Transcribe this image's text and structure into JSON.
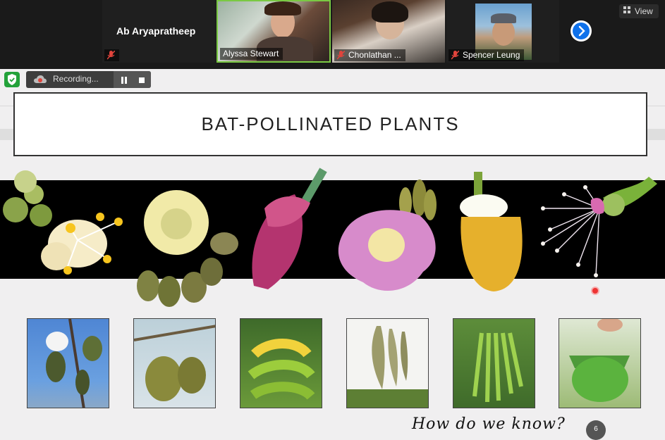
{
  "participants": [
    {
      "name": "Ab Aryapratheep",
      "muted": true
    },
    {
      "name": "Alyssa Stewart",
      "muted": false
    },
    {
      "name": "Chonlathan ...",
      "muted": true
    },
    {
      "name": "Spencer Leung",
      "muted": true
    }
  ],
  "view_button": {
    "label": "View",
    "icon": "grid-icon"
  },
  "recording": {
    "label": "Recording...",
    "pause_icon": "pause-icon",
    "stop_icon": "stop-icon"
  },
  "slide": {
    "title": "BAT-POLLINATED PLANTS",
    "footer": "How do we know?",
    "page_number": "6"
  },
  "colors": {
    "zoom_blue": "#0e71eb",
    "active_speaker": "#7ac943",
    "shield_green": "#23a13a",
    "mute_red": "#e0443c"
  }
}
